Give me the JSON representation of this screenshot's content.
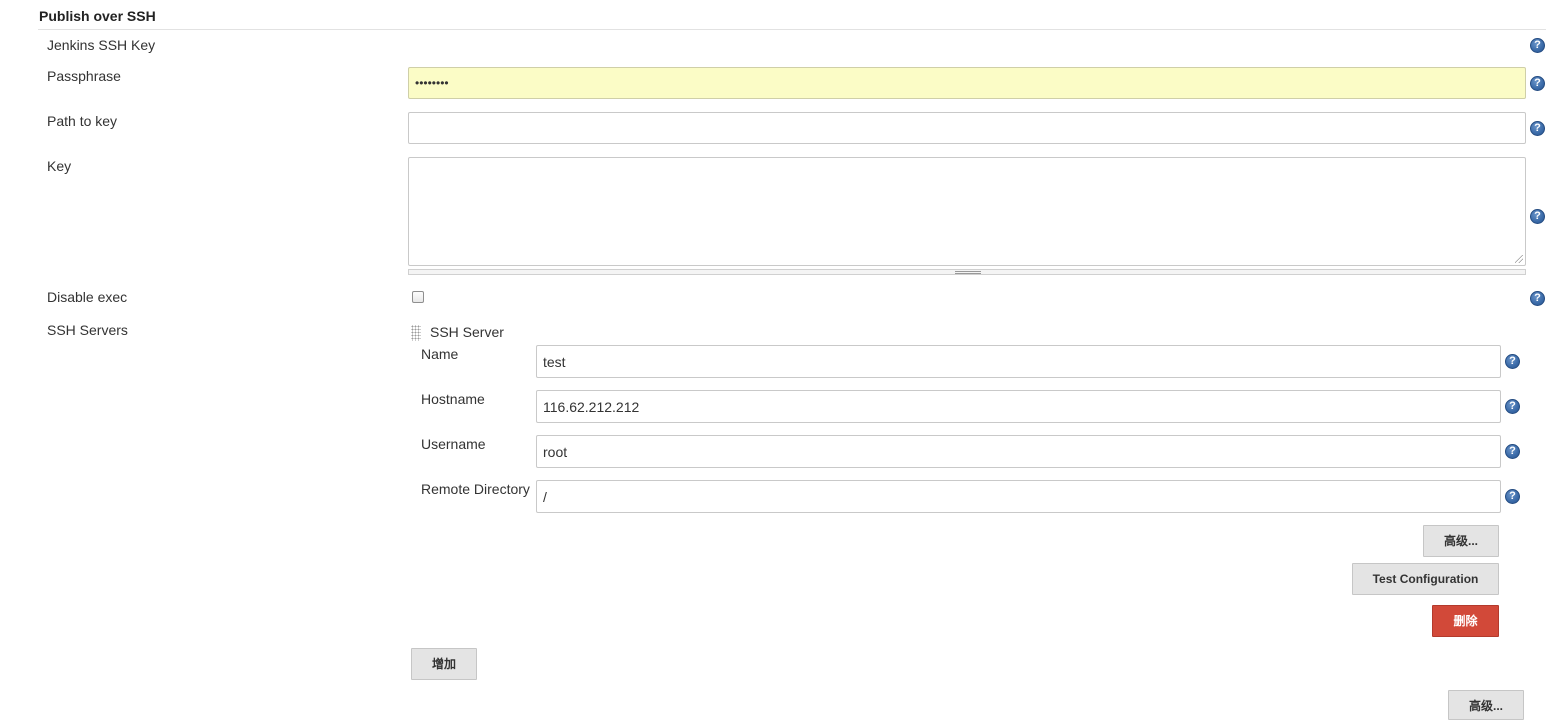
{
  "section": {
    "title": "Publish over SSH"
  },
  "fields": {
    "jenkins_ssh_key_label": "Jenkins SSH Key",
    "passphrase_label": "Passphrase",
    "passphrase_value": "••••••••",
    "path_to_key_label": "Path to key",
    "path_to_key_value": "",
    "key_label": "Key",
    "key_value": "",
    "disable_exec_label": "Disable exec",
    "disable_exec_checked": false,
    "ssh_servers_label": "SSH Servers"
  },
  "ssh_server": {
    "header": "SSH Server",
    "name_label": "Name",
    "name_value": "test",
    "hostname_label": "Hostname",
    "hostname_value": "116.62.212.212",
    "username_label": "Username",
    "username_value": "root",
    "remote_directory_label": "Remote Directory",
    "remote_directory_value": "/"
  },
  "buttons": {
    "advanced_server": "高级...",
    "test_configuration": "Test Configuration",
    "delete": "删除",
    "add": "增加",
    "advanced_bottom": "高级..."
  },
  "icons": {
    "help": "help-icon",
    "help_glyph": "?"
  },
  "colors": {
    "passphrase_bg": "#fbfcc6",
    "help_icon": "#3a6aa8",
    "delete_button": "#d24939",
    "button_bg": "#e4e4e4"
  }
}
